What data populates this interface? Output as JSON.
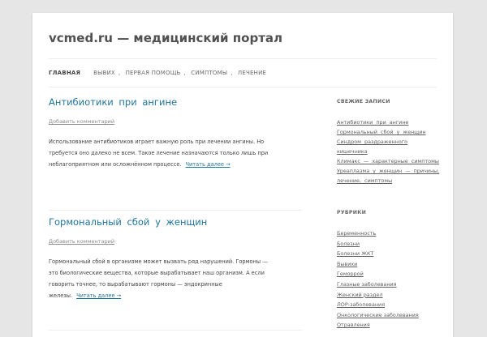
{
  "site": {
    "title": "vcmed.ru — медицинский портал"
  },
  "nav": {
    "home": "ГЛАВНАЯ",
    "items": [
      "ВЫВИХ",
      "ПЕРВАЯ ПОМОЩЬ",
      "СИМПТОМЫ",
      "ЛЕЧЕНИЕ"
    ]
  },
  "posts": [
    {
      "title": "Антибиотики при ангине",
      "comment": "Добавить комментарий",
      "text": "Использование антибиотиков играет важную роль при лечении ангины. Но требуется оно далеко не всем. Такое лечение назначаются только лишь при неблагоприятном или осложнённом процессе.",
      "more": "Читать далее →"
    },
    {
      "title": "Гормональный сбой у женщин",
      "comment": "Добавить комментарий",
      "text": "Гормональный сбой в организме может вызвать ряд нарушений. Гормоны — это биологические вещества, которые вырабатывает наш организм. А если говорить точнее, то вырабатывают гормоны — эндокринные железы.",
      "more": "Читать далее →"
    }
  ],
  "sidebar": {
    "recent_title": "СВЕЖИЕ ЗАПИСИ",
    "recent": [
      "Антибиотики при ангине",
      "Гормональный сбой у женщин",
      "Синдром раздраженного",
      "кишечника",
      "Климакс — характерные симптомы",
      "Уреаплазма у женщин — причины,",
      "лечение, симптомы"
    ],
    "cats_title": "РУБРИКИ",
    "cats": [
      "Беременность",
      "Болезни",
      "Болезни ЖКТ",
      "Вывихи",
      "Геморрой",
      "Глазные заболевания",
      "Женский раздел",
      "ЛОР-заболевания",
      "Онкологические заболевания",
      "Отравления"
    ]
  }
}
